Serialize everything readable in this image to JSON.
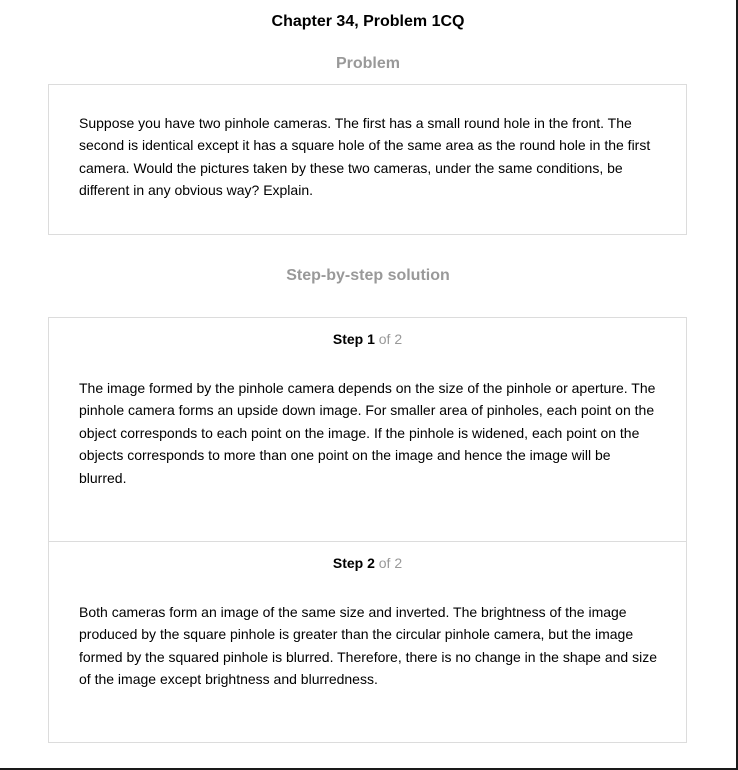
{
  "page": {
    "title": "Chapter 34, Problem 1CQ"
  },
  "problem": {
    "heading": "Problem",
    "text": "Suppose you have two pinhole cameras. The first has a small round hole in the front. The second is identical except it has a square hole of the same area as the round hole in the first camera. Would the pictures taken by these two cameras, under the same conditions, be different in any obvious way? Explain."
  },
  "solution": {
    "heading": "Step-by-step solution",
    "steps": [
      {
        "label": "Step 1",
        "of": "of 2",
        "text": "The image formed by the pinhole camera depends on the size of the pinhole or aperture. The pinhole camera forms an upside down image. For smaller area of pinholes, each point on the object corresponds to each point on the image. If the pinhole is widened, each point on the objects corresponds to more than one point on the image and hence the image will be blurred."
      },
      {
        "label": "Step 2",
        "of": "of 2",
        "text": "Both cameras form an image of the same size and inverted. The brightness of the image produced by the square pinhole is greater than the circular pinhole camera, but the image formed by the squared pinhole is blurred. Therefore, there is no change in the shape and size of the image except brightness and blurredness."
      }
    ]
  }
}
